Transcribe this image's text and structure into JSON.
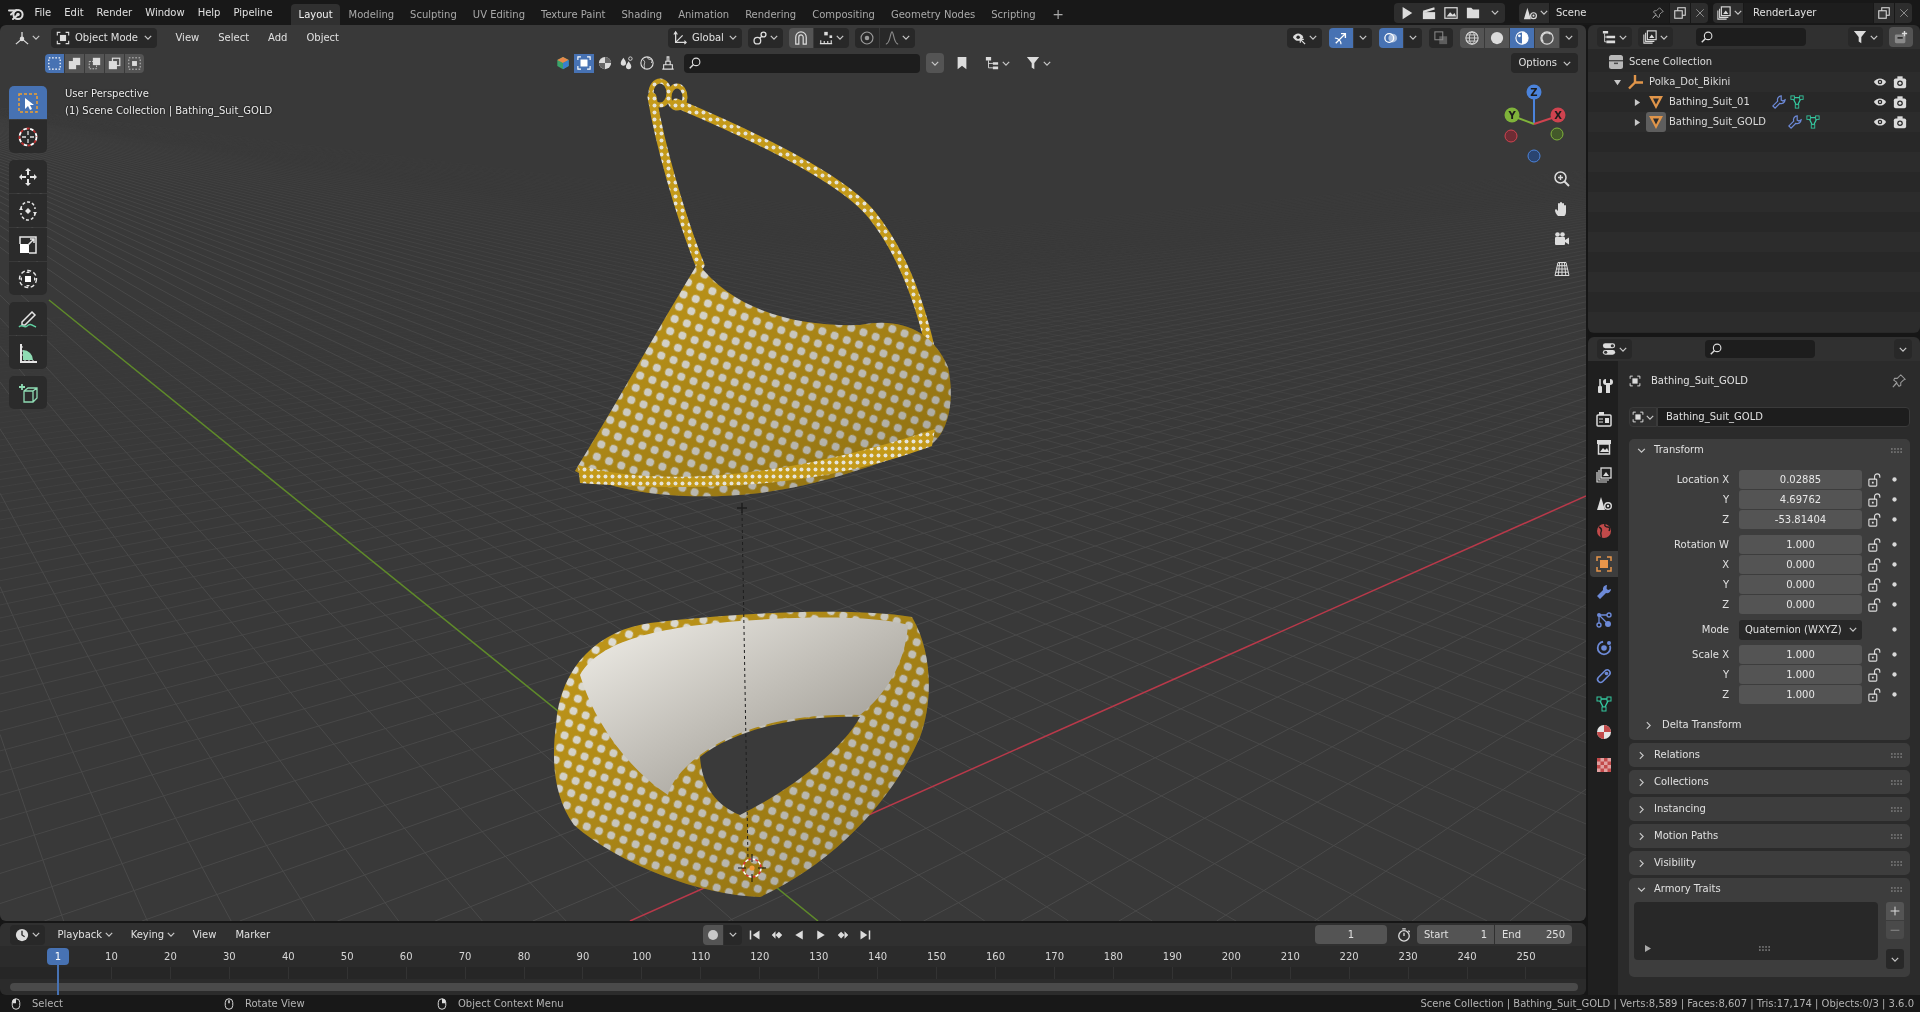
{
  "topbar": {
    "menus": [
      "File",
      "Edit",
      "Render",
      "Window",
      "Help",
      "Pipeline"
    ],
    "workspaces": [
      {
        "label": "Layout",
        "selected": true
      },
      {
        "label": "Modeling",
        "selected": false
      },
      {
        "label": "Sculpting",
        "selected": false
      },
      {
        "label": "UV Editing",
        "selected": false
      },
      {
        "label": "Texture Paint",
        "selected": false
      },
      {
        "label": "Shading",
        "selected": false
      },
      {
        "label": "Animation",
        "selected": false
      },
      {
        "label": "Rendering",
        "selected": false
      },
      {
        "label": "Compositing",
        "selected": false
      },
      {
        "label": "Geometry Nodes",
        "selected": false
      },
      {
        "label": "Scripting",
        "selected": false
      }
    ],
    "add_workspace": "+",
    "scene": "Scene",
    "view_layer": "RenderLayer"
  },
  "viewport": {
    "mode": "Object Mode",
    "menus": [
      "View",
      "Select",
      "Add",
      "Object"
    ],
    "orientation": "Global",
    "toggles": [
      {
        "kind": "gizmos",
        "on": true
      },
      {
        "kind": "overlays",
        "on": true
      },
      {
        "kind": "xray",
        "on": false
      }
    ],
    "shading": [
      {
        "kind": "wireframe",
        "selected": false
      },
      {
        "kind": "solid",
        "selected": false
      },
      {
        "kind": "material",
        "selected": true
      },
      {
        "kind": "rendered",
        "selected": false
      }
    ],
    "select_modes": [
      {
        "kind": "set",
        "selected": true
      },
      {
        "kind": "extend",
        "selected": false
      },
      {
        "kind": "subtract",
        "selected": false
      },
      {
        "kind": "invert",
        "selected": false
      },
      {
        "kind": "intersect",
        "selected": false
      }
    ],
    "filters": [
      {
        "kind": "all",
        "selected": false
      },
      {
        "kind": "object",
        "selected": true
      },
      {
        "kind": "material",
        "selected": false
      },
      {
        "kind": "particles",
        "selected": false
      },
      {
        "kind": "world",
        "selected": false
      },
      {
        "kind": "brush",
        "selected": false
      }
    ],
    "options": "Options",
    "view_name": "User Perspective",
    "context": "(1) Scene Collection | Bathing_Suit_GOLD",
    "tool_groups": [
      [
        {
          "kind": "select",
          "selected": true
        },
        {
          "kind": "cursor",
          "selected": false
        }
      ],
      [
        {
          "kind": "move",
          "selected": false
        },
        {
          "kind": "rotate",
          "selected": false
        },
        {
          "kind": "scale",
          "selected": false
        },
        {
          "kind": "transform",
          "selected": false
        }
      ],
      [
        {
          "kind": "annotate",
          "selected": false
        },
        {
          "kind": "measure",
          "selected": false
        }
      ],
      [
        {
          "kind": "add",
          "selected": false
        }
      ]
    ],
    "gizmo_axes": [
      "Z",
      "Y",
      "X"
    ]
  },
  "outliner": {
    "tree": [
      {
        "label": "Scene Collection",
        "kind": "collection",
        "children": [
          {
            "label": "Polka_Dot_Bikini",
            "kind": "empty",
            "expanded": true,
            "active": false,
            "children": [
              {
                "label": "Bathing_Suit_01",
                "kind": "mesh",
                "expanded": false,
                "active": false
              },
              {
                "label": "Bathing_Suit_GOLD",
                "kind": "mesh",
                "expanded": false,
                "active": true
              }
            ]
          }
        ]
      }
    ]
  },
  "properties": {
    "tab_groups": [
      [
        {
          "kind": "tool",
          "selected": false
        }
      ],
      [
        {
          "kind": "render",
          "selected": false
        },
        {
          "kind": "output",
          "selected": false
        },
        {
          "kind": "view_layer",
          "selected": false
        },
        {
          "kind": "scene",
          "selected": false
        },
        {
          "kind": "world",
          "selected": false
        }
      ],
      [
        {
          "kind": "object",
          "selected": true
        },
        {
          "kind": "modifiers",
          "selected": false
        },
        {
          "kind": "particles",
          "selected": false
        },
        {
          "kind": "physics",
          "selected": false
        },
        {
          "kind": "constraints",
          "selected": false
        },
        {
          "kind": "data",
          "selected": false
        },
        {
          "kind": "material",
          "selected": false
        }
      ],
      [
        {
          "kind": "texture",
          "selected": false
        }
      ]
    ],
    "object_name": "Bathing_Suit_GOLD",
    "name_field": "Bathing_Suit_GOLD",
    "transform": {
      "title": "Transform",
      "expanded": true,
      "groups": [
        [
          {
            "kind": "number",
            "label": "Location X",
            "value": "0.02885"
          },
          {
            "kind": "number",
            "label": "Y",
            "value": "4.69762"
          },
          {
            "kind": "number",
            "label": "Z",
            "value": "-53.81404"
          }
        ],
        [
          {
            "kind": "number",
            "label": "Rotation W",
            "value": "1.000"
          },
          {
            "kind": "number",
            "label": "X",
            "value": "0.000"
          },
          {
            "kind": "number",
            "label": "Y",
            "value": "0.000"
          },
          {
            "kind": "number",
            "label": "Z",
            "value": "0.000"
          }
        ],
        [
          {
            "kind": "dropdown",
            "label": "Mode",
            "value": "Quaternion (WXYZ)"
          }
        ],
        [
          {
            "kind": "number",
            "label": "Scale X",
            "value": "1.000"
          },
          {
            "kind": "number",
            "label": "Y",
            "value": "1.000"
          },
          {
            "kind": "number",
            "label": "Z",
            "value": "1.000"
          }
        ]
      ],
      "subpanel": {
        "title": "Delta Transform",
        "expanded": false
      }
    },
    "panels": [
      {
        "title": "Relations",
        "expanded": false
      },
      {
        "title": "Collections",
        "expanded": false
      },
      {
        "title": "Instancing",
        "expanded": false
      },
      {
        "title": "Motion Paths",
        "expanded": false
      },
      {
        "title": "Visibility",
        "expanded": false
      },
      {
        "title": "Armory Traits",
        "expanded": true
      }
    ]
  },
  "timeline": {
    "menus": [
      {
        "label": "Playback",
        "dropdown": true
      },
      {
        "label": "Keying",
        "dropdown": true
      },
      {
        "label": "View",
        "dropdown": false
      },
      {
        "label": "Marker",
        "dropdown": false
      }
    ],
    "auto_keying": false,
    "frame": "1",
    "start_label": "Start",
    "start": "1",
    "end_label": "End",
    "end": "250",
    "current_frame": "1",
    "ticks": [
      "10",
      "20",
      "30",
      "40",
      "50",
      "60",
      "70",
      "80",
      "90",
      "100",
      "110",
      "120",
      "130",
      "140",
      "150",
      "160",
      "170",
      "180",
      "190",
      "200",
      "210",
      "220",
      "230",
      "240",
      "250"
    ]
  },
  "status_bar": {
    "hints": [
      {
        "kind": "left",
        "label": "Select"
      },
      {
        "kind": "middle",
        "label": "Rotate View"
      },
      {
        "kind": "right",
        "label": "Object Context Menu"
      }
    ],
    "stats": "Scene Collection | Bathing_Suit_GOLD | Verts:8,589 | Faces:8,607 | Tris:17,174 | Objects:0/3 | 3.6.0"
  }
}
